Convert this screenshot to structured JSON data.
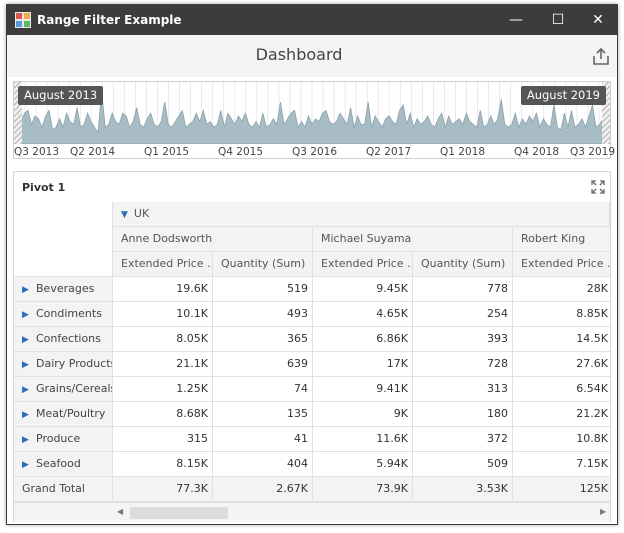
{
  "window": {
    "title": "Range Filter Example",
    "min_glyph": "—",
    "max_glyph": "☐",
    "close_glyph": "✕",
    "icon": "app-grid-icon"
  },
  "dashboard": {
    "title": "Dashboard",
    "export_icon": "export-icon"
  },
  "range_filter": {
    "start_label": "August 2013",
    "end_label": "August 2019",
    "tick_labels": [
      "Q3 2013",
      "Q2 2014",
      "Q1 2015",
      "Q4 2015",
      "Q3 2016",
      "Q2 2017",
      "Q1 2018",
      "Q4 2018",
      "Q3 2019"
    ],
    "fill_color": "#a7bcc4",
    "stroke_color": "#8aa2ab"
  },
  "chart_data": {
    "type": "area",
    "x": [
      "Q3 2013",
      "Q2 2014",
      "Q1 2015",
      "Q4 2015",
      "Q3 2016",
      "Q2 2017",
      "Q1 2018",
      "Q4 2018",
      "Q3 2019"
    ],
    "values": [
      0.3,
      0.45,
      0.4,
      0.55,
      0.6,
      0.35,
      0.5,
      0.45,
      0.3,
      0.5,
      0.6,
      0.25,
      0.3,
      0.45,
      0.3,
      0.55,
      0.4,
      0.35,
      0.65,
      0.3,
      0.35,
      0.55,
      0.4,
      0.3,
      0.2,
      0.95,
      0.3,
      0.35,
      0.55,
      0.4,
      0.35,
      0.55,
      0.5,
      0.3,
      0.4,
      0.65,
      0.35,
      0.3,
      0.45,
      0.55,
      0.35,
      0.3,
      0.4,
      0.75,
      0.35,
      0.3,
      0.4,
      0.5,
      0.6,
      0.3,
      0.35,
      0.4,
      0.55,
      0.4,
      0.6,
      0.35,
      0.4,
      0.3,
      0.35,
      0.6,
      0.3,
      0.55,
      0.45,
      0.35,
      0.5,
      0.4,
      0.55,
      0.35,
      0.3,
      0.4,
      0.3,
      0.55,
      0.3,
      0.35,
      0.45,
      0.35,
      0.75,
      0.35,
      0.45,
      0.55,
      0.6,
      0.3,
      0.4,
      0.3,
      0.5,
      0.35,
      0.45,
      0.4,
      0.55,
      0.6,
      0.4,
      0.35,
      0.4,
      0.55,
      0.45,
      0.35,
      0.65,
      0.3,
      0.5,
      0.35,
      0.35,
      0.75,
      0.3,
      0.5,
      0.4,
      0.3,
      0.45,
      0.5,
      0.4,
      0.35,
      0.6,
      0.7,
      0.35,
      0.55,
      0.3,
      0.45,
      0.35,
      0.4,
      0.5,
      0.35,
      0.3,
      0.45,
      0.55,
      0.3,
      0.5,
      0.35,
      0.4,
      0.45,
      0.35,
      0.55,
      0.4,
      0.35,
      0.3,
      0.6,
      0.3,
      0.35,
      0.5,
      0.35,
      0.45,
      0.8,
      0.35,
      0.3,
      0.35,
      0.55,
      0.3,
      0.45,
      0.35,
      0.5,
      0.4,
      0.55,
      0.3,
      0.45,
      0.35,
      0.3,
      0.7,
      0.3,
      0.25,
      0.55,
      0.3,
      0.6,
      0.3,
      0.35,
      0.45,
      0.3,
      0.5,
      0.7,
      0.3,
      0.35,
      0.45,
      0.4,
      0.3
    ],
    "ylim": [
      0,
      1
    ]
  },
  "pivot": {
    "title": "Pivot 1",
    "maximize_icon": "maximize-icon",
    "column_group": "UK",
    "people": [
      "Anne Dodsworth",
      "Michael Suyama",
      "Robert King"
    ],
    "measures": [
      "Extended Price ...",
      "Quantity (Sum)",
      "Extended Price ...",
      "Quantity (Sum)",
      "Extended Price ..."
    ],
    "rows": [
      {
        "label": "Beverages",
        "values": [
          "19.6K",
          "519",
          "9.45K",
          "778",
          "28K"
        ]
      },
      {
        "label": "Condiments",
        "values": [
          "10.1K",
          "493",
          "4.65K",
          "254",
          "8.85K"
        ]
      },
      {
        "label": "Confections",
        "values": [
          "8.05K",
          "365",
          "6.86K",
          "393",
          "14.5K"
        ]
      },
      {
        "label": "Dairy Products",
        "values": [
          "21.1K",
          "639",
          "17K",
          "728",
          "27.6K"
        ]
      },
      {
        "label": "Grains/Cereals",
        "values": [
          "1.25K",
          "74",
          "9.41K",
          "313",
          "6.54K"
        ]
      },
      {
        "label": "Meat/Poultry",
        "values": [
          "8.68K",
          "135",
          "9K",
          "180",
          "21.2K"
        ]
      },
      {
        "label": "Produce",
        "values": [
          "315",
          "41",
          "11.6K",
          "372",
          "10.8K"
        ]
      },
      {
        "label": "Seafood",
        "values": [
          "8.15K",
          "404",
          "5.94K",
          "509",
          "7.15K"
        ]
      }
    ],
    "grand_total": {
      "label": "Grand Total",
      "values": [
        "77.3K",
        "2.67K",
        "73.9K",
        "3.53K",
        "125K"
      ]
    }
  }
}
